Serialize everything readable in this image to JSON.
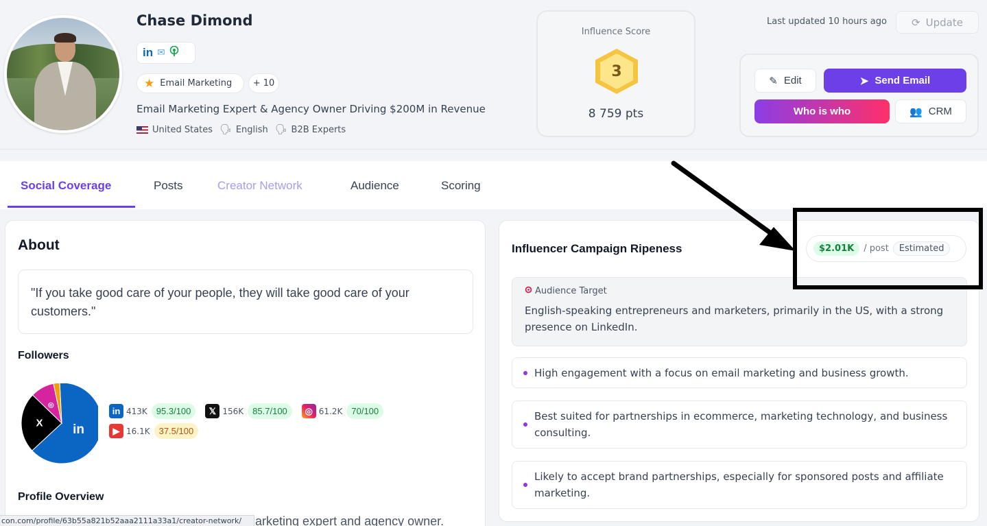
{
  "profile": {
    "name": "Chase Dimond",
    "tag_main": "Email Marketing",
    "tag_more": "+ 10",
    "bio": "Email Marketing Expert & Agency Owner Driving $200M in Revenue",
    "country": "United States",
    "language": "English",
    "category": "B2B Experts",
    "social_icons": [
      "linkedin-icon",
      "mail-icon",
      "podcast-icon"
    ]
  },
  "score": {
    "label": "Influence Score",
    "rank": "3",
    "points": "8 759 pts"
  },
  "header_actions": {
    "last_updated": "Last updated 10 hours ago",
    "update_label": "Update",
    "edit_label": "Edit",
    "send_email_label": "Send Email",
    "who_is_who_label": "Who is who",
    "crm_label": "CRM"
  },
  "tabs": [
    {
      "label": "Social Coverage",
      "state": "active"
    },
    {
      "label": "Posts",
      "state": "normal"
    },
    {
      "label": "Creator Network",
      "state": "muted"
    },
    {
      "label": "Audience",
      "state": "normal"
    },
    {
      "label": "Scoring",
      "state": "normal"
    }
  ],
  "about": {
    "title": "About",
    "quote": "\"If you take good care of your people, they will take good care of your customers.\"",
    "followers_title": "Followers",
    "overview_title": "Profile Overview",
    "overview_text": "arketing expert and agency owner."
  },
  "followers": [
    {
      "platform": "linkedin",
      "icon": "linkedin-icon",
      "count": "413K",
      "score": "95.3/100",
      "status": "good",
      "share": 0.641
    },
    {
      "platform": "x",
      "icon": "x-icon",
      "count": "156K",
      "score": "85.7/100",
      "status": "good",
      "share": 0.242
    },
    {
      "platform": "instagram",
      "icon": "instagram-icon",
      "count": "61.2K",
      "score": "70/100",
      "status": "good",
      "share": 0.095
    },
    {
      "platform": "youtube",
      "icon": "youtube-icon",
      "count": "16.1K",
      "score": "37.5/100",
      "status": "warn",
      "share": 0.025
    }
  ],
  "ripeness": {
    "title": "Influencer Campaign Ripeness",
    "price": "$2.01K",
    "per": "/ post",
    "estimated": "Estimated",
    "target_label": "Audience Target",
    "target_text": "English-speaking entrepreneurs and marketers, primarily in the US, with a strong presence on LinkedIn.",
    "bullets": [
      "High engagement with a focus on email marketing and business growth.",
      "Best suited for partnerships in ecommerce, marketing technology, and business consulting.",
      "Likely to accept brand partnerships, especially for sponsored posts and affiliate marketing."
    ]
  },
  "status_bar": {
    "url": "con.com/profile/63b55a821b52aaa2111a33a1/creator-network/"
  },
  "colors": {
    "accent": "#6d3fe6",
    "linkedin": "#0a66c2",
    "good": "#15803d",
    "warn": "#b45309"
  }
}
